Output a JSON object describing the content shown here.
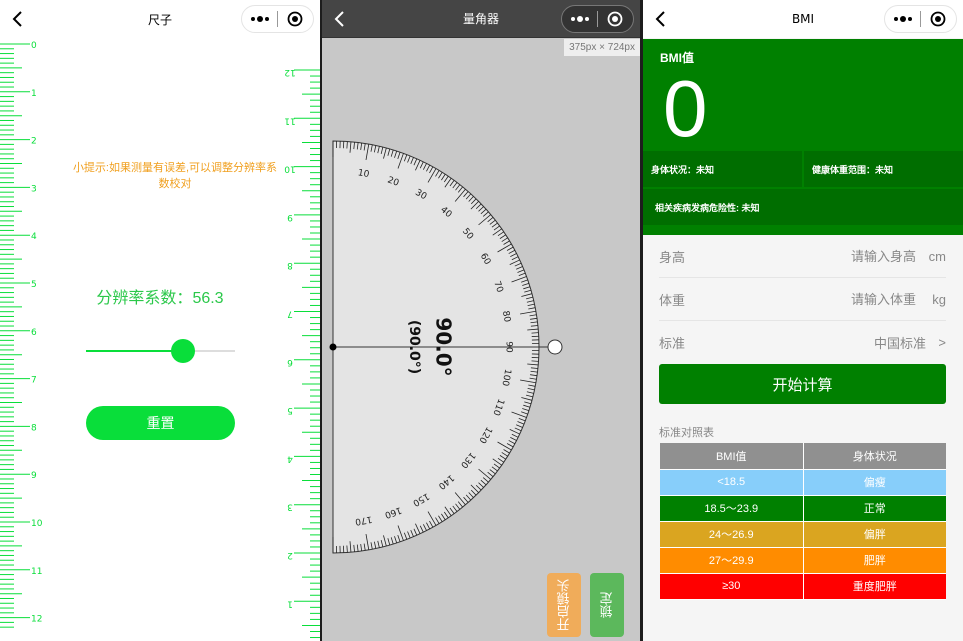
{
  "ruler_app": {
    "title": "尺子",
    "hint": "小提示:如果测量有误差,可以调整分辨率系数校对",
    "resolution_label": "分辨率系数：",
    "resolution_value": "56.3",
    "slider_level": 0.65,
    "reset_label": "重置",
    "left_scale": [
      "0",
      "1",
      "2",
      "3",
      "4",
      "5",
      "6",
      "7",
      "8",
      "9",
      "10",
      "11",
      "12"
    ],
    "right_scale": [
      "12",
      "11",
      "10",
      "9",
      "8",
      "7",
      "6",
      "5",
      "4",
      "3",
      "2",
      "1"
    ]
  },
  "protractor_app": {
    "title": "量角器",
    "size_label": "375px × 724px",
    "angle": "90.0°",
    "angle_alt": "(90.0°)",
    "scale_labels": [
      "10",
      "20",
      "30",
      "40",
      "50",
      "60",
      "70",
      "80",
      "90",
      "100",
      "110",
      "120",
      "130",
      "140",
      "150",
      "160",
      "170"
    ],
    "camera_label": "开启镜头",
    "lock_label": "锁定"
  },
  "bmi_app": {
    "title": "BMI",
    "bmi_label": "BMI值",
    "bmi_value": "0",
    "body_status": "身体状况：未知",
    "healthy_weight": "健康体重范围：未知",
    "disease_risk": "相关疾病发病危险性: 未知",
    "height_label": "身高",
    "height_placeholder": "请输入身高",
    "height_unit": "cm",
    "weight_label": "体重",
    "weight_placeholder": "请输入体重",
    "weight_unit": "kg",
    "standard_label": "标准",
    "standard_value": "中国标准",
    "standard_chevron": ">",
    "calc_label": "开始计算",
    "table_title": "标准对照表",
    "table_headers": [
      "BMI值",
      "身体状况"
    ],
    "table_rows": [
      {
        "range": "<18.5",
        "status": "偏瘦",
        "color": "#87cefa"
      },
      {
        "range": "18.5～23.9",
        "status": "正常",
        "color": "#008000"
      },
      {
        "range": "24～26.9",
        "status": "偏胖",
        "color": "#daa520"
      },
      {
        "range": "27～29.9",
        "status": "肥胖",
        "color": "#ff8c00"
      },
      {
        "range": "≥30",
        "status": "重度肥胖",
        "color": "#ff0000"
      }
    ],
    "header_color": "#909090"
  },
  "colors": {
    "ruler_green": "#09de3a",
    "hint_orange": "#f0a020",
    "bmi_green": "#008000"
  },
  "icons": [
    "back-arrow-icon",
    "more-dots-icon",
    "close-target-icon"
  ]
}
